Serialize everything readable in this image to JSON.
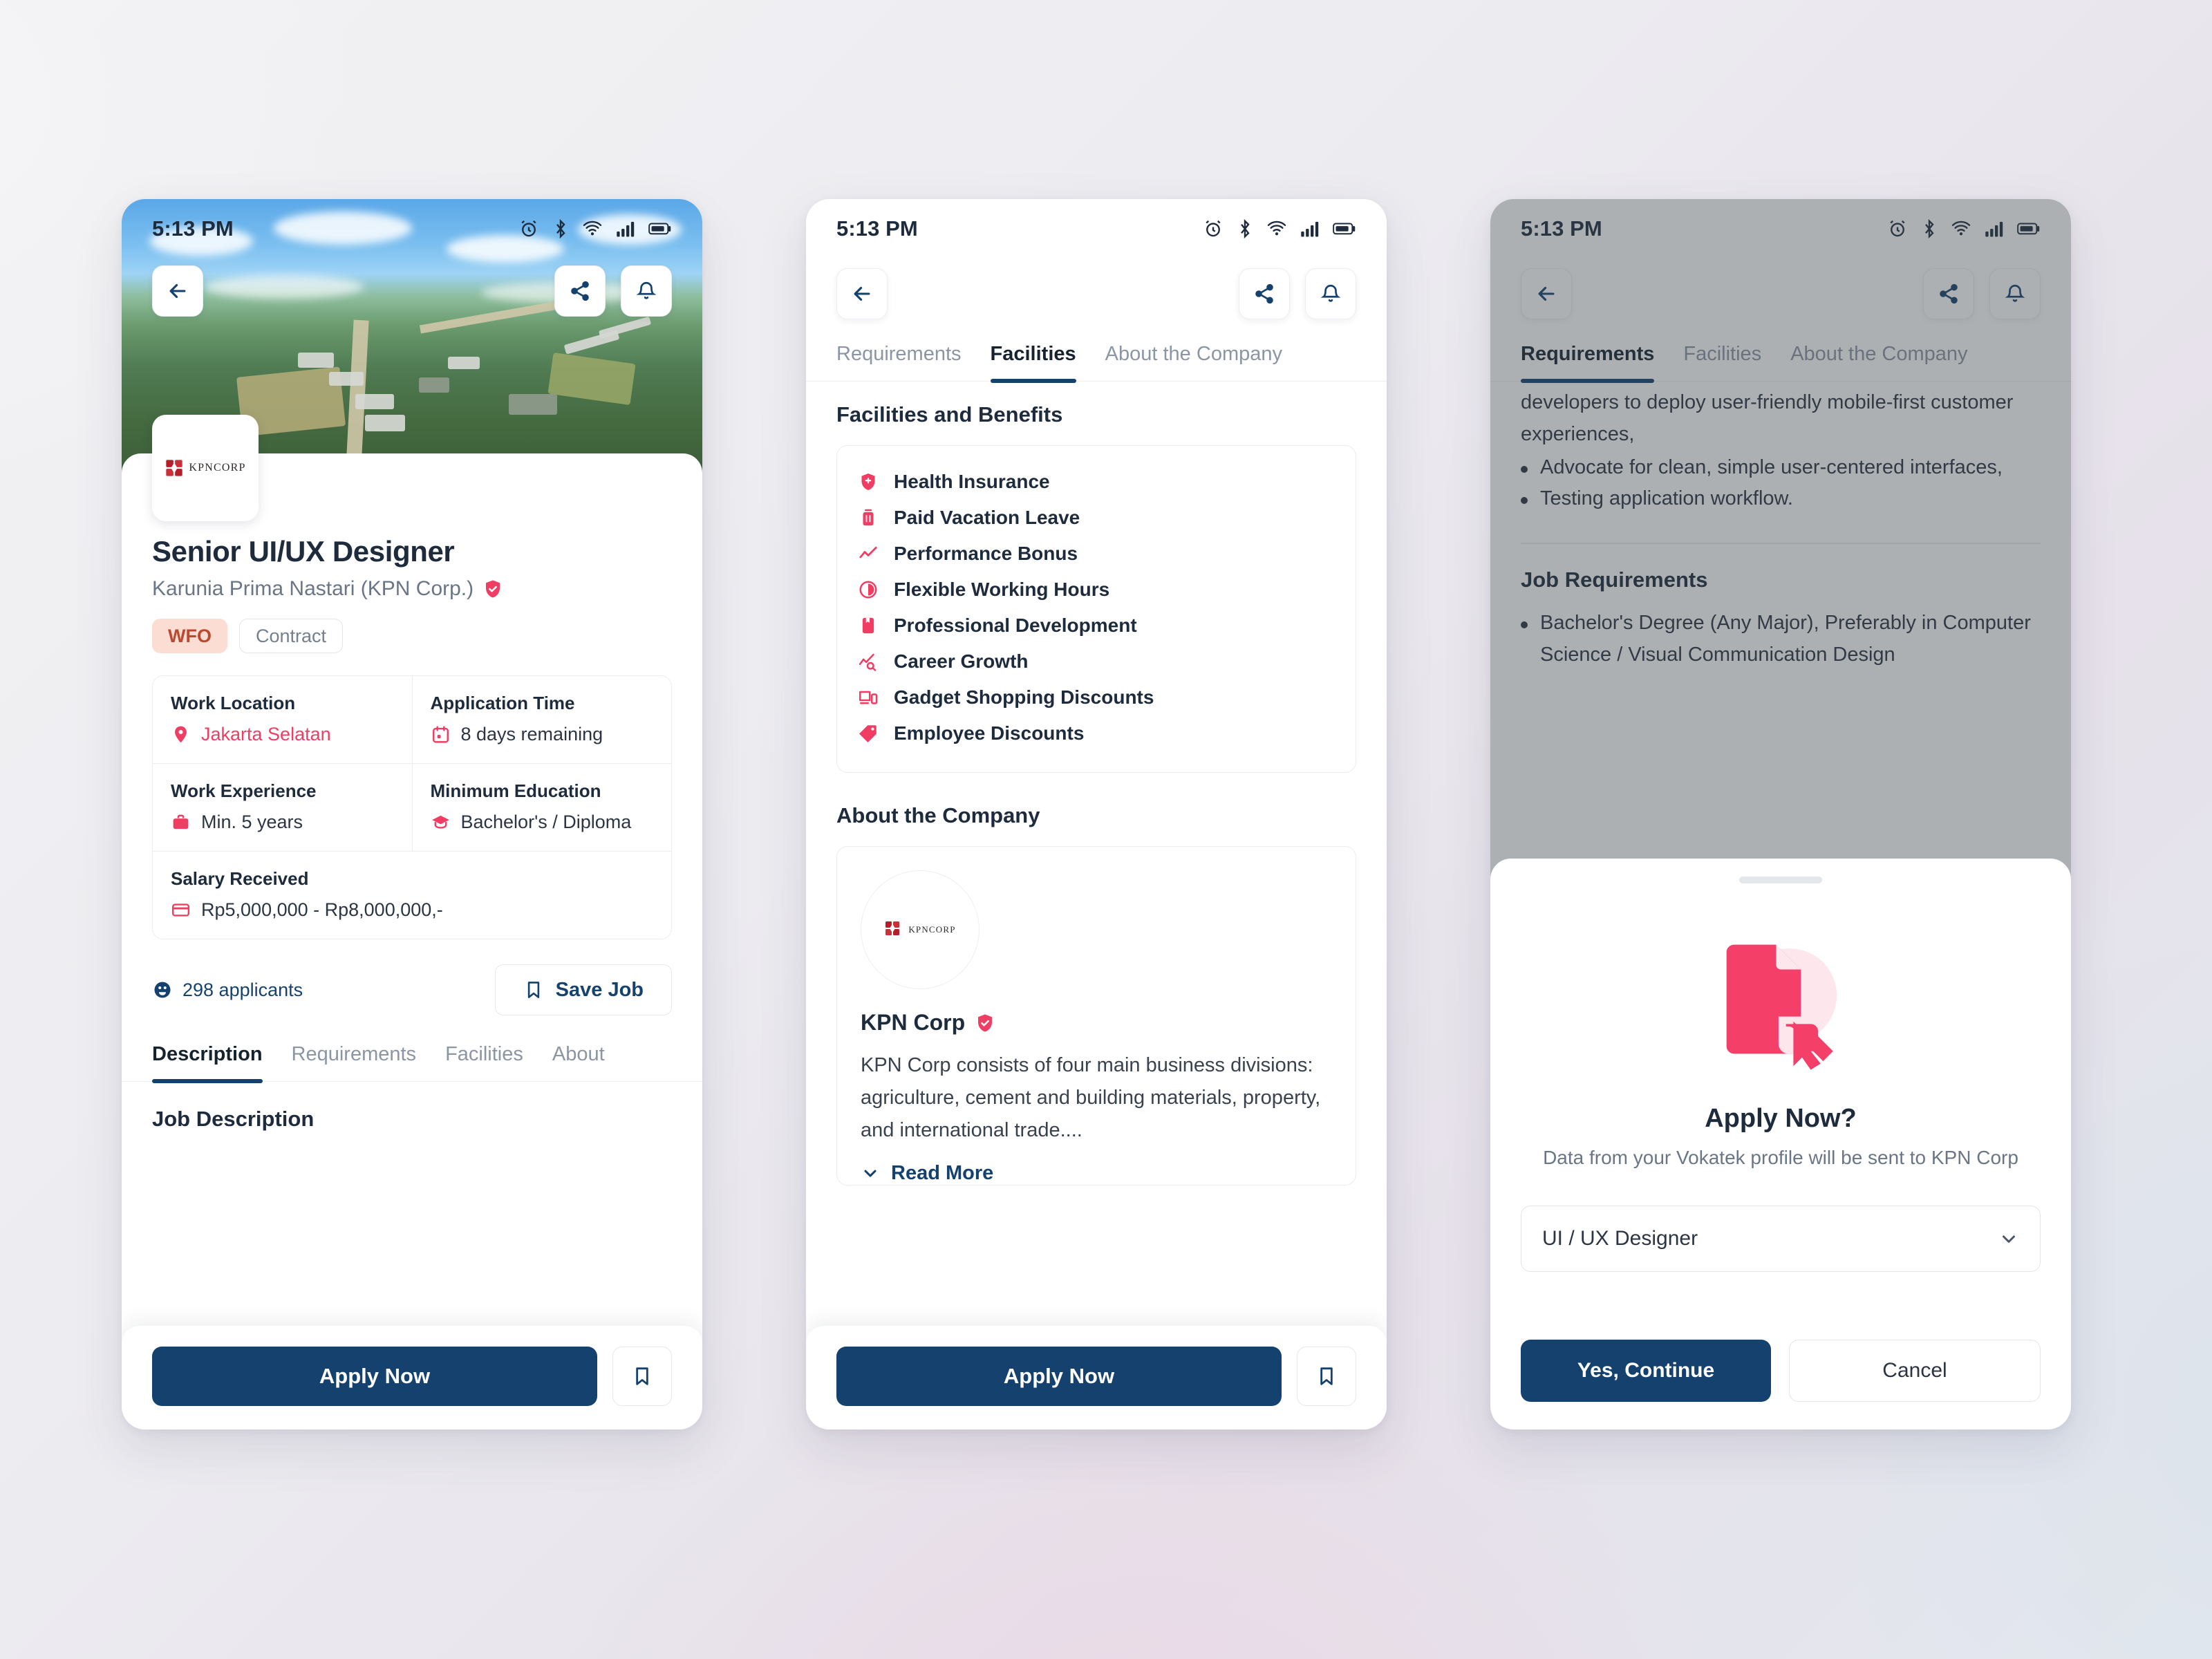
{
  "status_bar": {
    "time": "5:13 PM",
    "icons": [
      "alarm-icon",
      "bluetooth-icon",
      "wifi-icon",
      "cellular-icon",
      "battery-icon"
    ]
  },
  "colors": {
    "primary_navy": "#14416d",
    "accent_pink": "#ef3d63",
    "chip_wfo_bg": "#fbddd3",
    "chip_wfo_text": "#b9492f"
  },
  "screen1": {
    "job_title": "Senior UI/UX Designer",
    "company_name": "Karunia Prima Nastari (KPN Corp.)",
    "verified": true,
    "logo_text": "KPNCORP",
    "chips": [
      {
        "label": "WFO",
        "style": "filled"
      },
      {
        "label": "Contract",
        "style": "outline"
      }
    ],
    "details": [
      {
        "label": "Work Location",
        "value": "Jakarta Selatan",
        "icon": "location-pin-icon",
        "accent": true
      },
      {
        "label": "Application Time",
        "value": "8 days remaining",
        "icon": "calendar-icon",
        "accent": false
      },
      {
        "label": "Work Experience",
        "value": "Min. 5 years",
        "icon": "briefcase-icon",
        "accent": false
      },
      {
        "label": "Minimum Education",
        "value": "Bachelor's / Diploma",
        "icon": "graduation-cap-icon",
        "accent": false
      },
      {
        "label": "Salary Received",
        "value": "Rp5,000,000 - Rp8,000,000,-",
        "icon": "credit-card-icon",
        "accent": false
      }
    ],
    "applicants": "298 applicants",
    "save_job": "Save Job",
    "tabs": [
      {
        "label": "Description",
        "active": true
      },
      {
        "label": "Requirements",
        "active": false
      },
      {
        "label": "Facilities",
        "active": false
      },
      {
        "label": "About",
        "active": false
      }
    ],
    "section_heading": "Job Description",
    "apply_button": "Apply Now"
  },
  "screen2": {
    "tabs": [
      {
        "label": "Requirements",
        "active": false
      },
      {
        "label": "Facilities",
        "active": true
      },
      {
        "label": "About the Company",
        "active": false
      }
    ],
    "facilities_heading": "Facilities and Benefits",
    "facilities": [
      {
        "label": "Health Insurance",
        "icon": "shield-plus-icon"
      },
      {
        "label": "Paid Vacation Leave",
        "icon": "suitcase-icon"
      },
      {
        "label": "Performance Bonus",
        "icon": "trend-line-icon"
      },
      {
        "label": "Flexible Working Hours",
        "icon": "clock-half-icon"
      },
      {
        "label": "Professional Development",
        "icon": "bookmark-book-icon"
      },
      {
        "label": "Career Growth",
        "icon": "chart-search-icon"
      },
      {
        "label": "Gadget Shopping Discounts",
        "icon": "devices-icon"
      },
      {
        "label": "Employee Discounts",
        "icon": "price-tag-icon"
      }
    ],
    "about_heading": "About the Company",
    "company": {
      "logo_text": "KPNCORP",
      "name": "KPN Corp",
      "verified": true,
      "description": "KPN Corp consists of four main business divisions: agriculture, cement and building materials, property, and international trade....",
      "read_more": "Read More"
    },
    "apply_button": "Apply Now"
  },
  "screen3": {
    "tabs": [
      {
        "label": "Requirements",
        "active": true
      },
      {
        "label": "Facilities",
        "active": false
      },
      {
        "label": "About the Company",
        "active": false
      }
    ],
    "clipped_line": "developers to deploy user-friendly mobile-first customer experiences,",
    "description_bullets": [
      "Advocate for clean, simple user-centered interfaces,",
      "Testing application workflow."
    ],
    "requirements_heading": "Job Requirements",
    "requirement_bullets": [
      "Bachelor's Degree (Any Major), Preferably in Computer Science / Visual Communication Design"
    ],
    "modal": {
      "illustration": "document-apply-icon",
      "title": "Apply Now?",
      "subtitle": "Data from your Vokatek profile will be sent to KPN Corp",
      "select_value": "UI / UX Designer",
      "confirm_button": "Yes, Continue",
      "cancel_button": "Cancel"
    }
  }
}
